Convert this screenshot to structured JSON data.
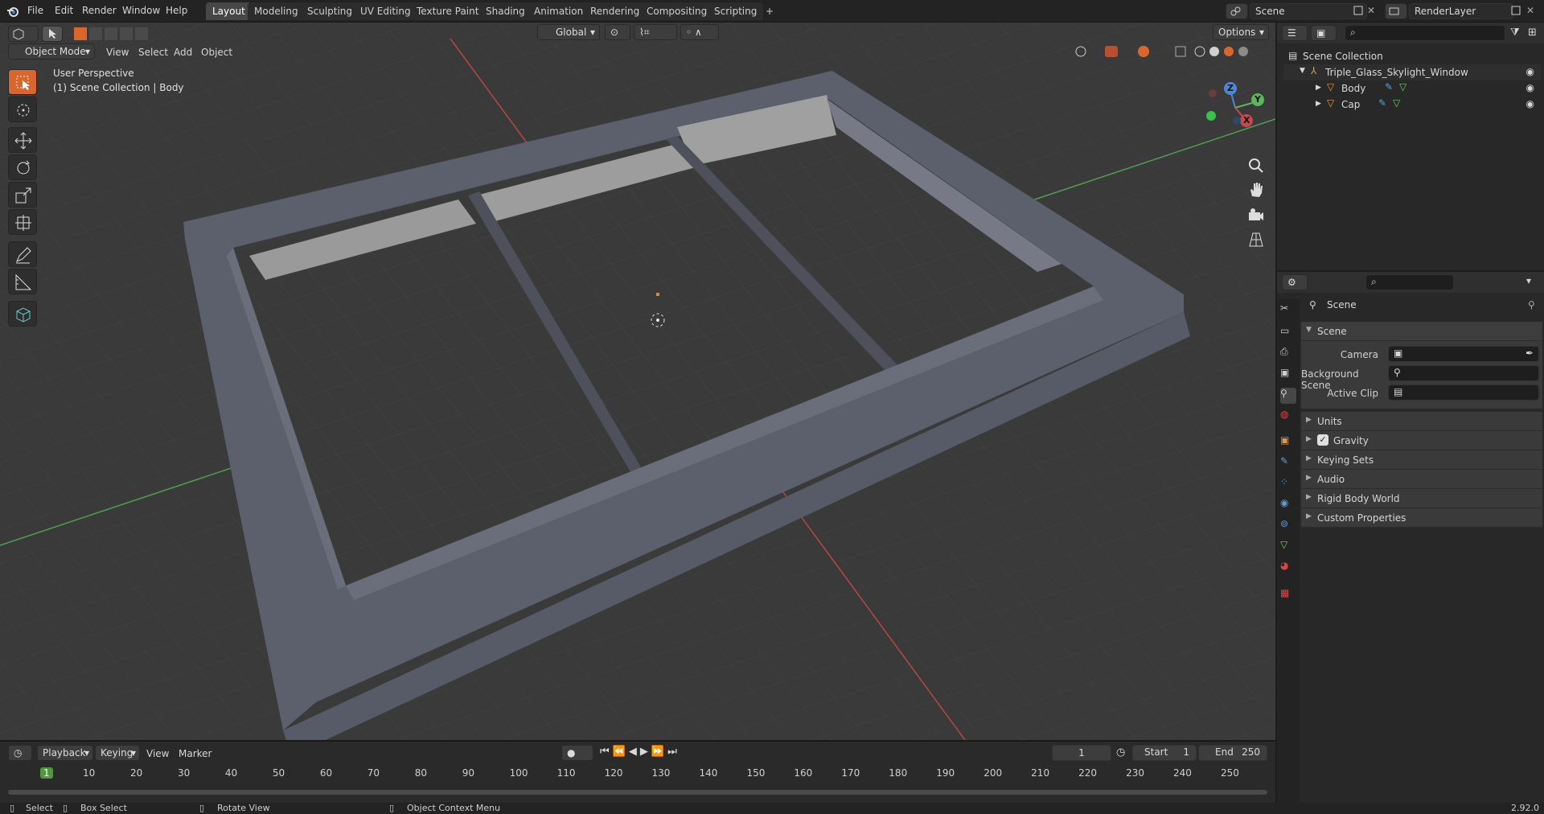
{
  "topbar": {
    "menus": [
      "File",
      "Edit",
      "Render",
      "Window",
      "Help"
    ],
    "workspaces": [
      "Layout",
      "Modeling",
      "Sculpting",
      "UV Editing",
      "Texture Paint",
      "Shading",
      "Animation",
      "Rendering",
      "Compositing",
      "Scripting"
    ],
    "active_workspace": "Layout",
    "add_tab": "+",
    "scene_name": "Scene",
    "view_layer": "RenderLayer"
  },
  "viewport_header": {
    "mode": "Object Mode",
    "menus": [
      "View",
      "Select",
      "Add",
      "Object"
    ],
    "transform_orientation": "Global",
    "options_label": "Options"
  },
  "viewport": {
    "overlay_line1": "User Perspective",
    "overlay_line2": "(1) Scene Collection | Body",
    "gizmo_x": "X",
    "gizmo_y": "Y",
    "gizmo_z": "Z",
    "colors": {
      "x_axis": "#c94848",
      "y_axis": "#58b85a",
      "z_axis": "#4b88d6",
      "frame": "#5f6270",
      "glass": "#9b9b9b",
      "grid": "#444444",
      "accent": "#d9672d"
    }
  },
  "outliner": {
    "root": "Scene Collection",
    "items": [
      {
        "name": "Triple_Glass_Skylight_Window",
        "level": 1
      },
      {
        "name": "Body",
        "level": 2
      },
      {
        "name": "Cap",
        "level": 2
      }
    ]
  },
  "properties": {
    "header_title": "Scene",
    "section": "Scene",
    "fields": [
      {
        "label": "Camera"
      },
      {
        "label": "Background Scene"
      },
      {
        "label": "Active Clip"
      }
    ],
    "panels": [
      "Units",
      "Gravity",
      "Keying Sets",
      "Audio",
      "Rigid Body World",
      "Custom Properties"
    ],
    "gravity_checked": true
  },
  "timeline": {
    "menus": [
      "Playback",
      "Keying",
      "View",
      "Marker"
    ],
    "current_frame": "1",
    "start_label": "Start",
    "start_value": "1",
    "end_label": "End",
    "end_value": "250",
    "ticks": [
      "1",
      "10",
      "20",
      "30",
      "40",
      "50",
      "60",
      "70",
      "80",
      "90",
      "100",
      "110",
      "120",
      "130",
      "140",
      "150",
      "160",
      "170",
      "180",
      "190",
      "200",
      "210",
      "220",
      "230",
      "240",
      "250"
    ]
  },
  "statusbar": {
    "select": "Select",
    "box_select": "Box Select",
    "rotate_view": "Rotate View",
    "context_menu": "Object Context Menu",
    "version": "2.92.0"
  }
}
